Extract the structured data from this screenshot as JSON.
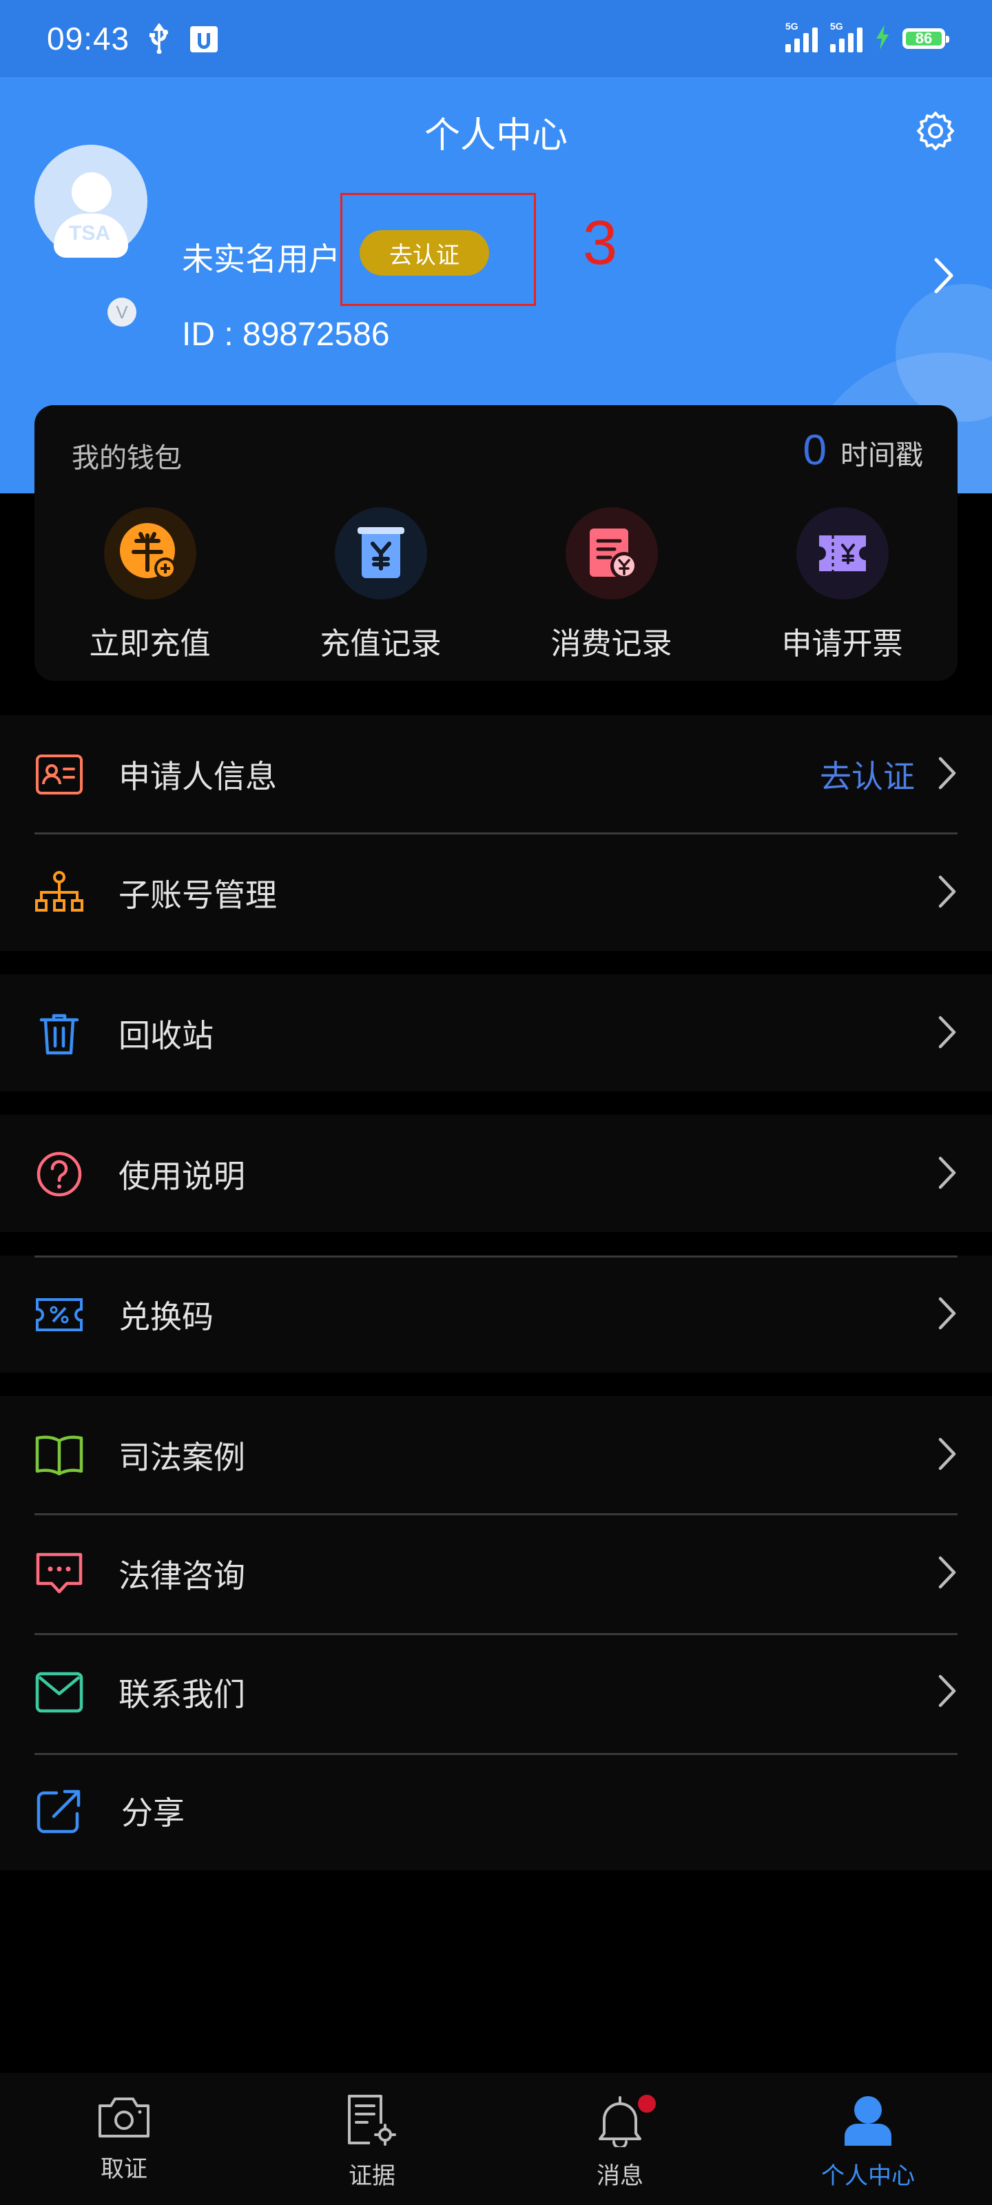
{
  "status_bar": {
    "time": "09:43",
    "network_1": "5G",
    "network_2": "5G",
    "battery": "86"
  },
  "header": {
    "title": "个人中心",
    "username": "未实名用户",
    "verify_label": "去认证",
    "annotation_number": "3",
    "user_id": "ID : 89872586",
    "avatar_text": "TSA",
    "avatar_badge": "V"
  },
  "wallet": {
    "title": "我的钱包",
    "balance": "0",
    "balance_unit": "时间戳",
    "actions": [
      {
        "label": "立即充值",
        "icon": "recharge-coin-icon",
        "color": "#ff9a1f"
      },
      {
        "label": "充值记录",
        "icon": "recharge-record-icon",
        "color": "#6aa6ff"
      },
      {
        "label": "消费记录",
        "icon": "consume-record-icon",
        "color": "#ff6b7e"
      },
      {
        "label": "申请开票",
        "icon": "invoice-ticket-icon",
        "color": "#a78bfa"
      }
    ]
  },
  "menu": {
    "applicant": {
      "label": "申请人信息",
      "extra": "去认证"
    },
    "sub_accounts": {
      "label": "子账号管理"
    },
    "recycle": {
      "label": "回收站"
    },
    "help": {
      "label": "使用说明"
    },
    "redeem": {
      "label": "兑换码"
    },
    "cases": {
      "label": "司法案例"
    },
    "legal": {
      "label": "法律咨询"
    },
    "contact": {
      "label": "联系我们"
    },
    "share": {
      "label": "分享"
    }
  },
  "tabs": [
    {
      "label": "取证",
      "icon": "camera-icon",
      "active": false
    },
    {
      "label": "证据",
      "icon": "evidence-doc-icon",
      "active": false
    },
    {
      "label": "消息",
      "icon": "bell-icon",
      "active": false
    },
    {
      "label": "个人中心",
      "icon": "person-icon",
      "active": true
    }
  ],
  "colors": {
    "header_blue": "#3a8ef6",
    "verify_gold": "#c9a20d",
    "link_blue": "#4d7fe6",
    "annotation_red": "#e8231d"
  }
}
